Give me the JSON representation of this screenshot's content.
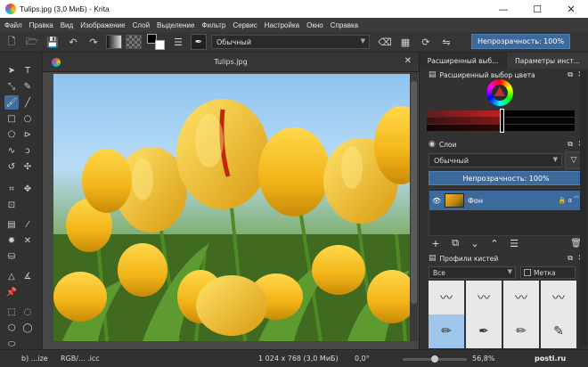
{
  "window": {
    "title": "Tulips.jpg (3,0 МиБ)  -  Krita",
    "controls": {
      "minimize": "—",
      "maximize": "☐",
      "close": "✕"
    }
  },
  "menu": [
    "Файл",
    "Правка",
    "Вид",
    "Изображение",
    "Слой",
    "Выделение",
    "Фильтр",
    "Сервис",
    "Настройка",
    "Окно",
    "Справка"
  ],
  "toolbar": {
    "blend_mode": "Обычный",
    "opacity": "Непрозрачность: 100%",
    "icons": [
      "new-document-icon",
      "open-icon",
      "save-icon",
      "undo-icon",
      "redo-icon",
      "gradient-icon",
      "pattern-icon",
      "fg-bg-color-icon",
      "brush-editor-icon",
      "brush-preset-icon",
      "eraser-icon",
      "alpha-lock-icon",
      "wrap-icon",
      "mirror-icon"
    ]
  },
  "document": {
    "tab_title": "Tulips.jpg",
    "tab_close": "✕"
  },
  "dock": {
    "tabs": [
      "Расширенный выб...",
      "Параметры инст..."
    ],
    "color_panel": {
      "title": "Расширенный выбор цвета",
      "close": "✕",
      "float": "⧉"
    },
    "layers_panel": {
      "title": "Слои",
      "close": "✕",
      "float": "⧉",
      "blend_mode": "Обычный",
      "opacity": "Непрозрачность:  100%",
      "layers": [
        {
          "name": "Фон",
          "props": "🔒 α ⁀"
        }
      ]
    },
    "presets_panel": {
      "title": "Профили кистей",
      "close": "✕",
      "float": "⧉",
      "filter": "Все",
      "tag": "Метка"
    }
  },
  "status": {
    "left": "b) ...ize",
    "color_space": "RGB/... .icc",
    "dimensions": "1 024 x 768 (3,0 МиБ)",
    "rotation": "0,0°",
    "zoom": "56,8%",
    "watermark": "posti.ru"
  },
  "colors": {
    "accent": "#3d6a9c",
    "background": "#313131"
  }
}
